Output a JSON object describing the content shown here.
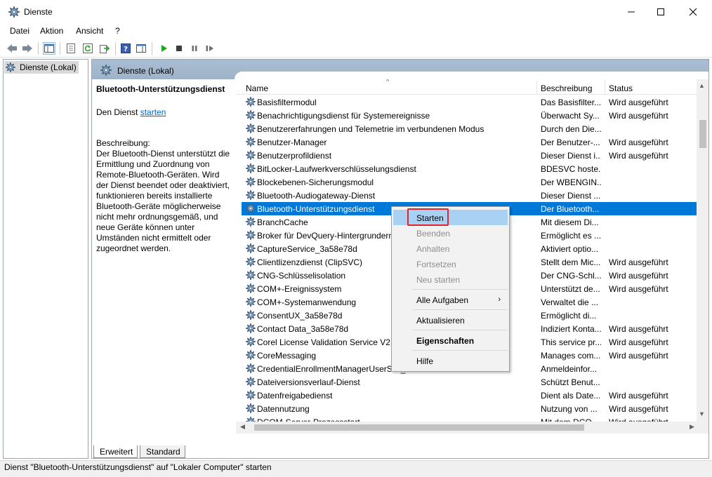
{
  "window": {
    "title": "Dienste"
  },
  "menu": [
    "Datei",
    "Aktion",
    "Ansicht",
    "?"
  ],
  "tree": {
    "root_label": "Dienste (Lokal)"
  },
  "panel": {
    "title": "Dienste (Lokal)"
  },
  "details": {
    "service_name": "Bluetooth-Unterstützungsdienst",
    "start_prefix": "Den Dienst ",
    "start_link": "starten",
    "desc_label": "Beschreibung:",
    "desc_text": "Der Bluetooth-Dienst unterstützt die Ermittlung und Zuordnung von Remote-Bluetooth-Geräten. Wird der Dienst beendet oder deaktiviert, funktionieren bereits installierte Bluetooth-Geräte möglicherweise nicht mehr ordnungsgemäß, und neue Geräte können unter Umständen nicht ermittelt oder zugeordnet werden."
  },
  "columns": {
    "name": "Name",
    "description": "Beschreibung",
    "status": "Status"
  },
  "services": [
    {
      "name": "Basisfiltermodul",
      "description": "Das Basisfilter...",
      "status": "Wird ausgeführt"
    },
    {
      "name": "Benachrichtigungsdienst für Systemereignisse",
      "description": "Überwacht Sy...",
      "status": "Wird ausgeführt"
    },
    {
      "name": "Benutzererfahrungen und Telemetrie im verbundenen Modus",
      "description": "Durch den Die...",
      "status": ""
    },
    {
      "name": "Benutzer-Manager",
      "description": "Der Benutzer-...",
      "status": "Wird ausgeführt"
    },
    {
      "name": "Benutzerprofildienst",
      "description": "Dieser Dienst i...",
      "status": "Wird ausgeführt"
    },
    {
      "name": "BitLocker-Laufwerkverschlüsselungsdienst",
      "description": "BDESVC hoste...",
      "status": ""
    },
    {
      "name": "Blockebenen-Sicherungsmodul",
      "description": "Der WBENGIN...",
      "status": ""
    },
    {
      "name": "Bluetooth-Audiogateway-Dienst",
      "description": "Dieser Dienst ...",
      "status": ""
    },
    {
      "name": "Bluetooth-Unterstützungsdienst",
      "description": "Der Bluetooth...",
      "status": ""
    },
    {
      "name": "BranchCache",
      "description": "Mit diesem Di...",
      "status": ""
    },
    {
      "name": "Broker für DevQuery-Hintergrunderm",
      "description": "Ermöglicht es ...",
      "status": ""
    },
    {
      "name": "CaptureService_3a58e78d",
      "description": "Aktiviert optio...",
      "status": ""
    },
    {
      "name": "Clientlizenzdienst (ClipSVC)",
      "description": "Stellt dem Mic...",
      "status": "Wird ausgeführt"
    },
    {
      "name": "CNG-Schlüsselisolation",
      "description": "Der CNG-Schl...",
      "status": "Wird ausgeführt"
    },
    {
      "name": "COM+-Ereignissystem",
      "description": "Unterstützt de...",
      "status": "Wird ausgeführt"
    },
    {
      "name": "COM+-Systemanwendung",
      "description": "Verwaltet die ...",
      "status": ""
    },
    {
      "name": "ConsentUX_3a58e78d",
      "description": "Ermöglicht di...",
      "status": ""
    },
    {
      "name": "Contact Data_3a58e78d",
      "description": "Indiziert Konta...",
      "status": "Wird ausgeführt"
    },
    {
      "name": "Corel License Validation Service V2, P",
      "description": "This service pr...",
      "status": "Wird ausgeführt"
    },
    {
      "name": "CoreMessaging",
      "description": "Manages com...",
      "status": "Wird ausgeführt"
    },
    {
      "name": "CredentialEnrollmentManagerUserSvc_3a58e78d",
      "description": "Anmeldeinfor...",
      "status": ""
    },
    {
      "name": "Dateiversionsverlauf-Dienst",
      "description": "Schützt Benut...",
      "status": ""
    },
    {
      "name": "Datenfreigabedienst",
      "description": "Dient als Date...",
      "status": "Wird ausgeführt"
    },
    {
      "name": "Datennutzung",
      "description": "Nutzung von ...",
      "status": "Wird ausgeführt"
    },
    {
      "name": "DCOM-Server-Prozessstart",
      "description": "Mit dem DCO...",
      "status": "Wird ausgeführt"
    }
  ],
  "context_menu": {
    "start": "Starten",
    "stop": "Beenden",
    "pause": "Anhalten",
    "resume": "Fortsetzen",
    "restart": "Neu starten",
    "all_tasks": "Alle Aufgaben",
    "refresh": "Aktualisieren",
    "properties": "Eigenschaften",
    "help": "Hilfe"
  },
  "tabs": [
    "Erweitert",
    "Standard"
  ],
  "statusbar": {
    "text": "Dienst \"Bluetooth-Unterstützungsdienst\" auf \"Lokaler Computer\" starten"
  },
  "colors": {
    "selection": "#0078d7",
    "menu_hover": "#a8d1f3",
    "highlight_box": "#e0242b",
    "panel_header": "#a9bdd3"
  }
}
